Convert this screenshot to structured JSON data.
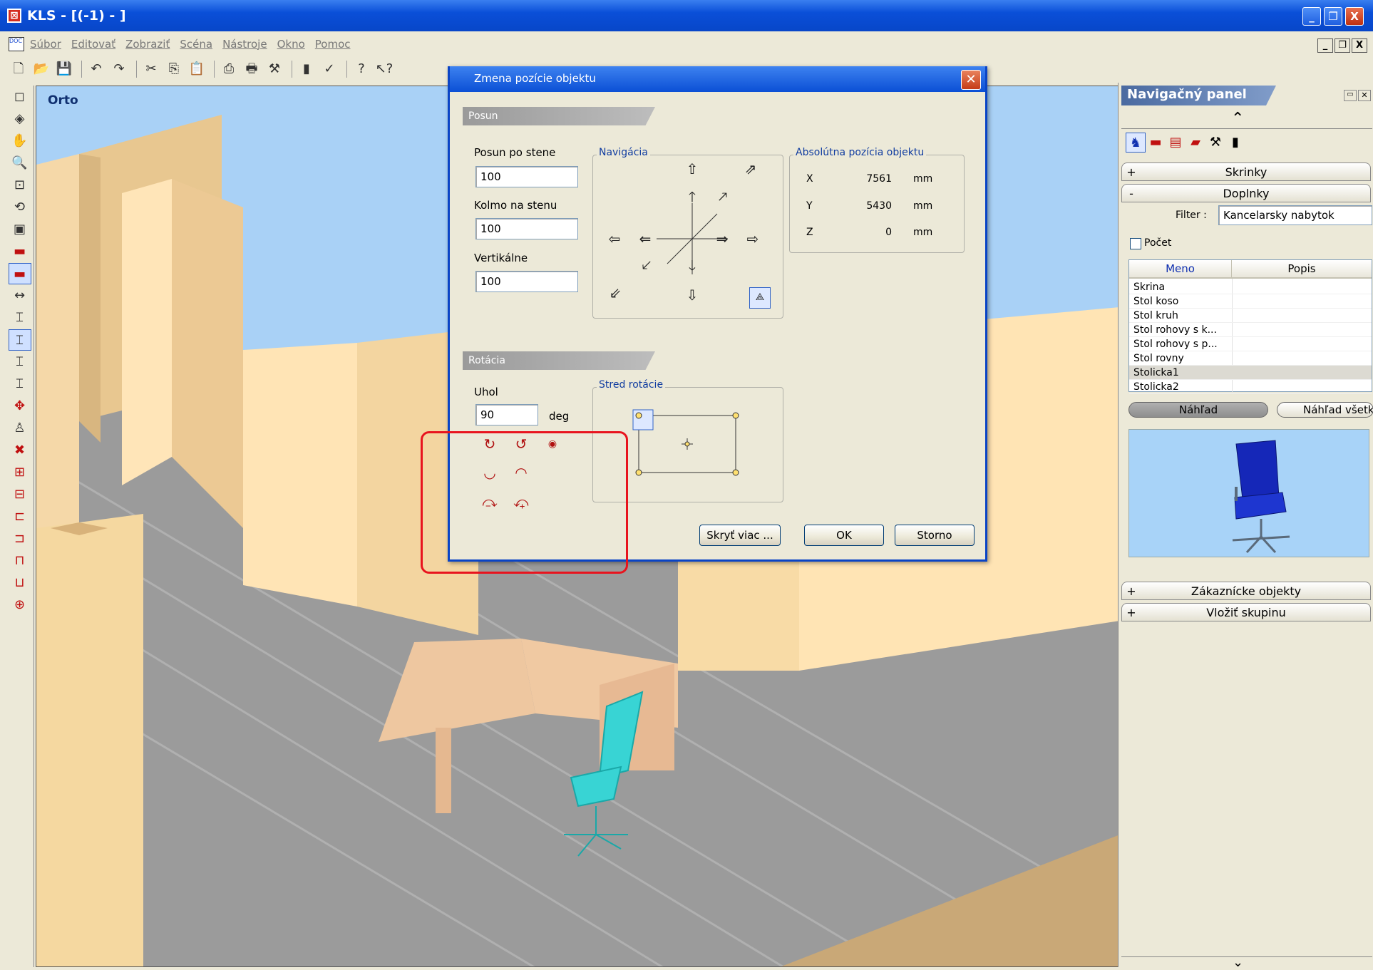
{
  "window": {
    "title": "KLS - [(-1) - ]",
    "minimize_label": "_",
    "restore_label": "❐",
    "close_label": "X"
  },
  "menu": {
    "items": [
      "Súbor",
      "Editovať",
      "Zobraziť",
      "Scéna",
      "Nástroje",
      "Okno",
      "Pomoc"
    ],
    "mdi_min": "_",
    "mdi_restore": "❐",
    "mdi_close": "X"
  },
  "viewport": {
    "label": "Orto"
  },
  "dialog": {
    "title": "Zmena pozície objektu",
    "close_label": "✕",
    "posun": {
      "section": "Posun",
      "posun_po_stene_label": "Posun po stene",
      "posun_po_stene_value": "100",
      "kolmo_label": "Kolmo na stenu",
      "kolmo_value": "100",
      "vertikalne_label": "Vertikálne",
      "vertikalne_value": "100",
      "navigacia_label": "Navigácia"
    },
    "absolute": {
      "label": "Absolútna pozícia objektu",
      "rows": [
        {
          "axis": "X",
          "value": "7561",
          "unit": "mm"
        },
        {
          "axis": "Y",
          "value": "5430",
          "unit": "mm"
        },
        {
          "axis": "Z",
          "value": "0",
          "unit": "mm"
        }
      ]
    },
    "rotacia": {
      "section": "Rotácia",
      "uhol_label": "Uhol",
      "uhol_value": "90",
      "unit": "deg",
      "stred_label": "Stred rotácie"
    },
    "buttons": {
      "skryt": "Skryť viac ...",
      "ok": "OK",
      "storno": "Storno"
    }
  },
  "nav_panel": {
    "title": "Navigačný panel",
    "sections": [
      {
        "symbol": "+",
        "label": "Skrinky"
      },
      {
        "symbol": "-",
        "label": "Doplnky"
      }
    ],
    "filter_label": "Filter :",
    "filter_value": "Kancelarsky nabytok",
    "pocet_label": "Počet",
    "table": {
      "headers": [
        "Meno",
        "Popis"
      ],
      "rows": [
        "Skrina",
        "Stol koso",
        "Stol kruh",
        "Stol rohovy s k...",
        "Stol rohovy s p...",
        "Stol rovny",
        "Stolicka1",
        "Stolicka2"
      ],
      "selected": "Stolicka1"
    },
    "nahlad": "Náhľad",
    "nahlad_vsetko": "Náhľad všetk",
    "bottom_sections": [
      {
        "symbol": "+",
        "label": "Zákaznícke objekty"
      },
      {
        "symbol": "+",
        "label": "Vložiť skupinu"
      }
    ]
  }
}
